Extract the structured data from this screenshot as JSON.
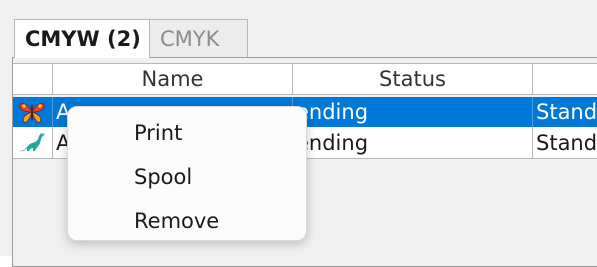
{
  "tabs": [
    {
      "label": "CMYW (2)",
      "active": true
    },
    {
      "label": "CMYK",
      "active": false
    }
  ],
  "table": {
    "columns": [
      "",
      "Name",
      "Status",
      ""
    ],
    "rows": [
      {
        "icon": "butterfly-icon",
        "name": "A",
        "status": "ending",
        "extra": "Stand",
        "selected": true
      },
      {
        "icon": "dinosaur-icon",
        "name": "A",
        "status": "ending",
        "extra": "Stand",
        "selected": false
      }
    ]
  },
  "context_menu": {
    "items": [
      "Print",
      "Spool",
      "Remove"
    ]
  },
  "colors": {
    "selection": "#0078d7",
    "grid_line": "#b8b8b8",
    "background": "#f0f0f0"
  }
}
